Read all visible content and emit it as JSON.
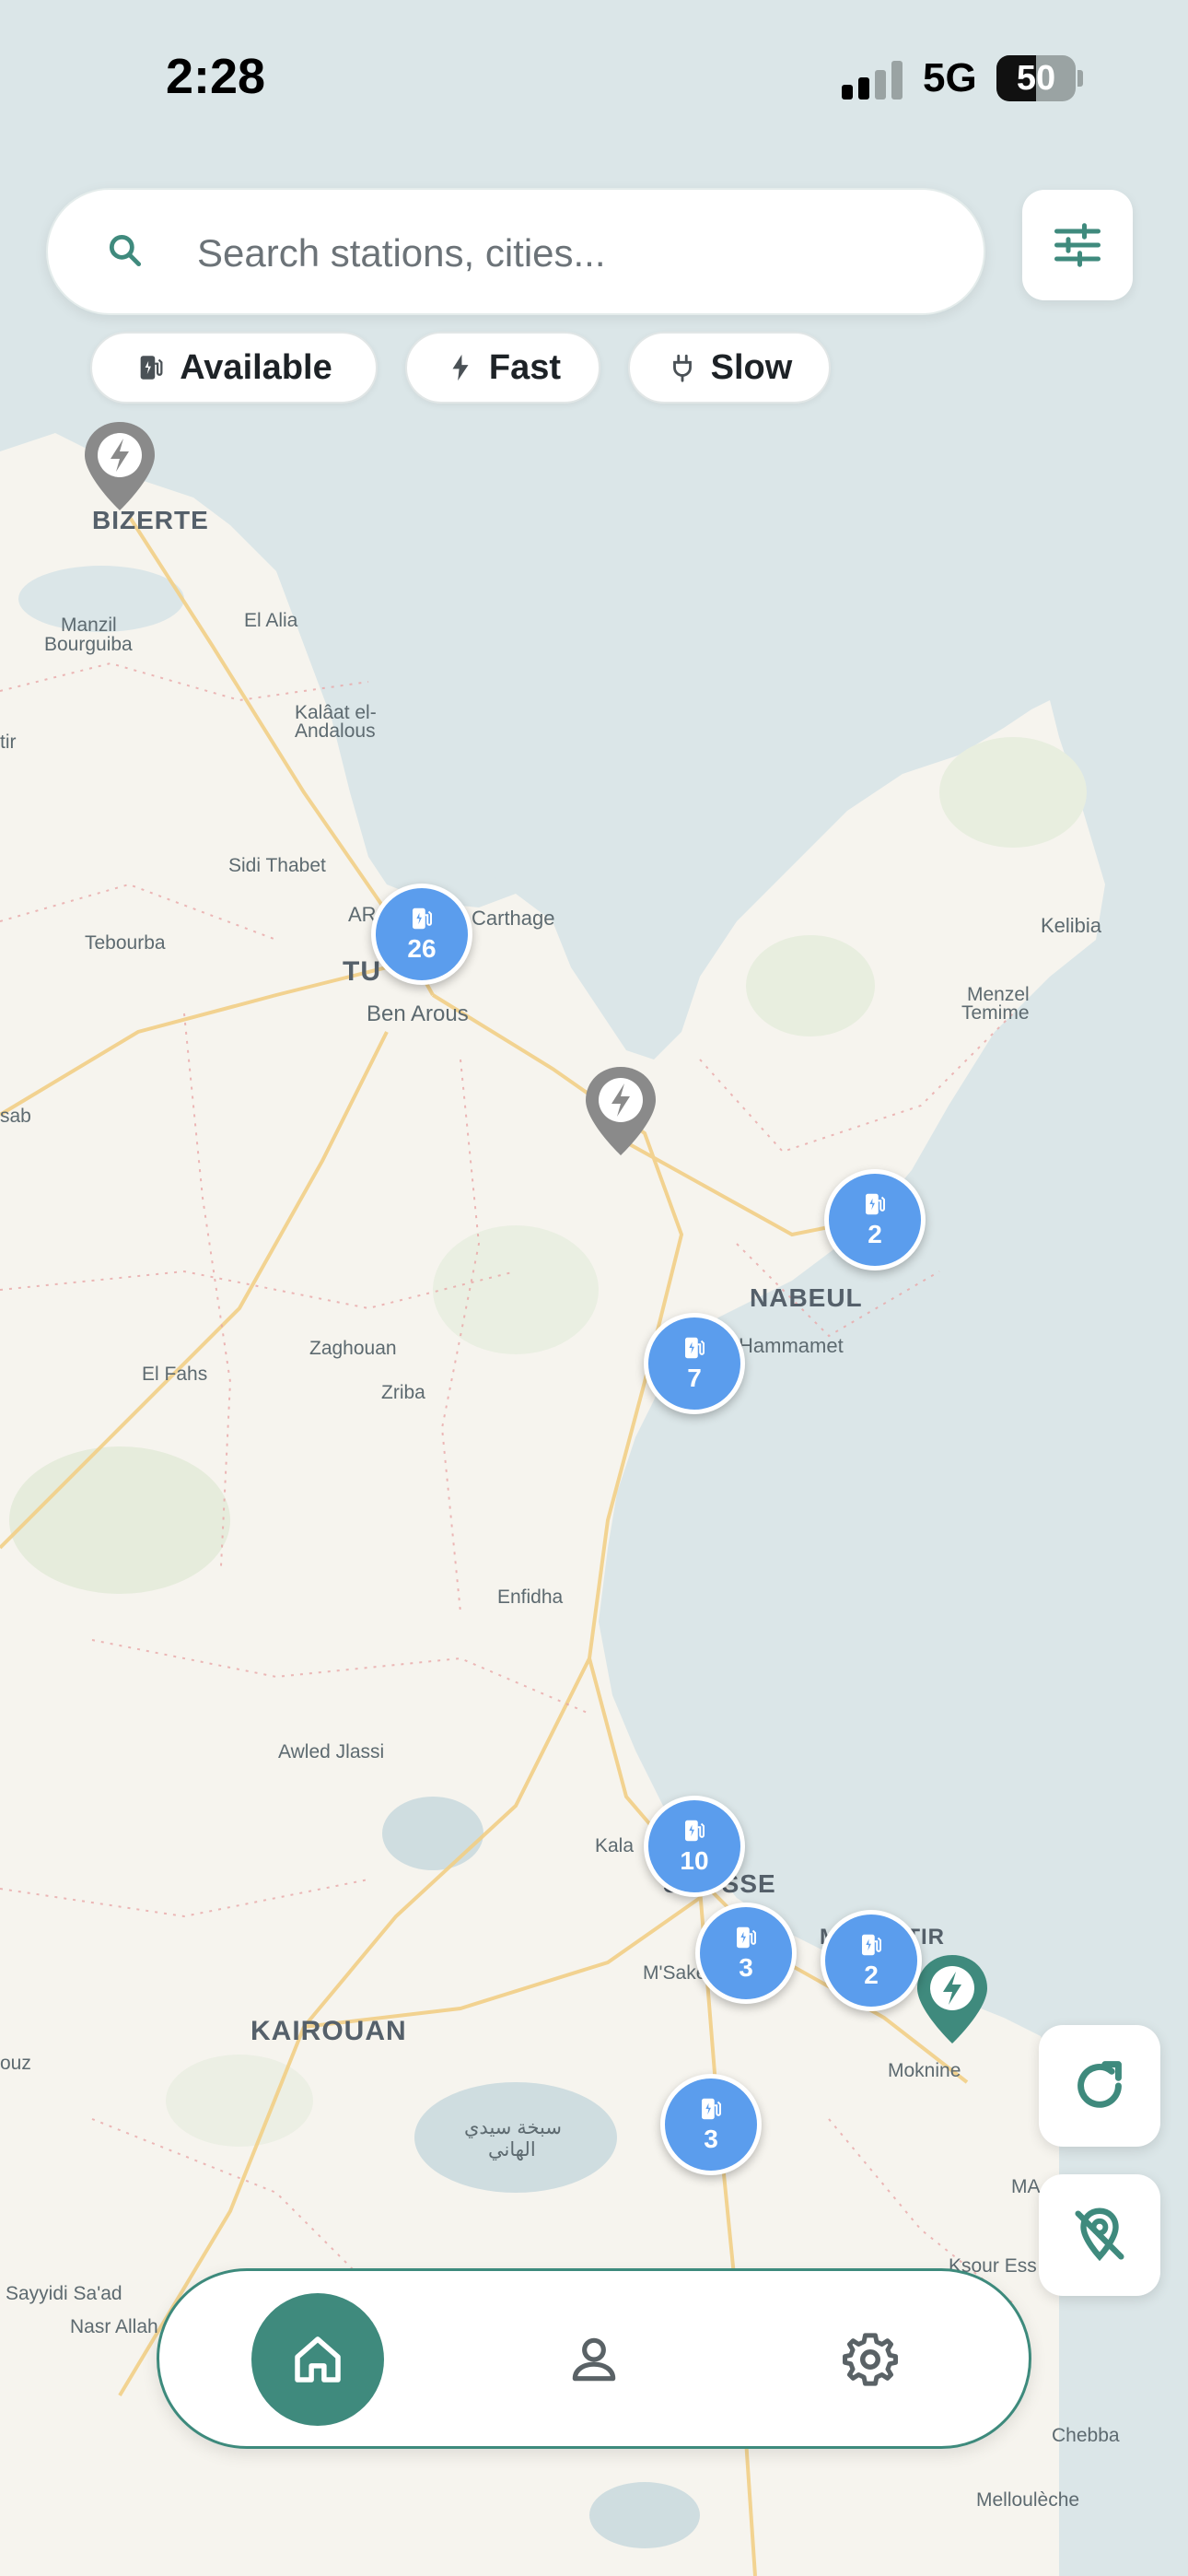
{
  "status_bar": {
    "time": "2:28",
    "network": "5G",
    "battery_level": "50"
  },
  "search": {
    "placeholder": "Search stations, cities..."
  },
  "filters": [
    {
      "label": "Available",
      "icon": "ev-station-icon"
    },
    {
      "label": "Fast",
      "icon": "lightning-icon"
    },
    {
      "label": "Slow",
      "icon": "plug-icon"
    }
  ],
  "map": {
    "cities": [
      "BIZERTE",
      "Manzil Bourguiba",
      "El Alia",
      "Kalâat el-",
      "Andalous",
      "Sidi Thabet",
      "Tebourba",
      "AR",
      "Carthage",
      "TU",
      "Ben Arous",
      "Kelibia",
      "Menzel",
      "Temime",
      "NABEUL",
      "Hammamet",
      "Zaghouan",
      "Zriba",
      "El Fahs",
      "Enfidha",
      "Awled Jlassi",
      "KAIROUAN",
      "SOUSSE",
      "M'Saken",
      "Moknine",
      "MA",
      "Ksour Ess",
      "Sayyidi Sa'ad",
      "Nasr Allah",
      "Chebba",
      "Melloulèche",
      "sab",
      "tir",
      "ouz",
      "Kala",
      "MONASTIR",
      "سبخة سيدي",
      "الهاني"
    ],
    "clusters": [
      {
        "count": "26"
      },
      {
        "count": "2"
      },
      {
        "count": "7"
      },
      {
        "count": "10"
      },
      {
        "count": "3"
      },
      {
        "count": "2"
      },
      {
        "count": "3"
      }
    ],
    "pins": [
      {
        "status": "offline",
        "color": "#8a8a8a"
      },
      {
        "status": "offline",
        "color": "#8a8a8a"
      },
      {
        "status": "available",
        "color": "#3f8a7d"
      }
    ]
  },
  "colors": {
    "accent": "#3f8a7d",
    "cluster": "#5b9ded",
    "water": "#dbe6e8",
    "land": "#f6f4ee"
  },
  "nav": {
    "items": [
      "home-icon",
      "profile-icon",
      "settings-icon"
    ],
    "active": "home"
  },
  "actions": [
    "refresh-icon",
    "location-off-icon"
  ]
}
